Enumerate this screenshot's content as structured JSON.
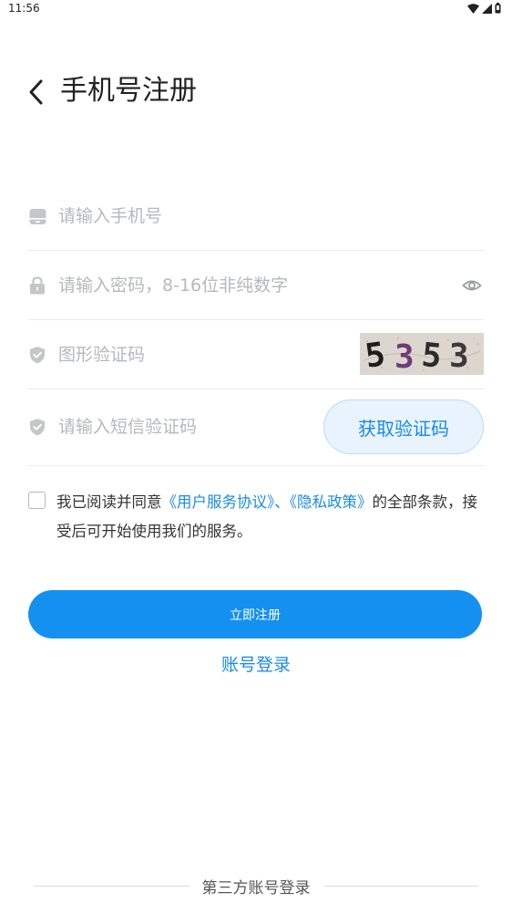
{
  "status_bar": {
    "time": "11:56"
  },
  "header": {
    "title": "手机号注册"
  },
  "form": {
    "phone": {
      "placeholder": "请输入手机号",
      "icon": "phone-icon"
    },
    "password": {
      "placeholder": "请输入密码，8-16位非纯数字",
      "icon": "lock-icon",
      "toggle_icon": "eye-icon"
    },
    "captcha": {
      "placeholder": "图形验证码",
      "icon": "shield-check-icon",
      "captcha_text": "5353"
    },
    "sms": {
      "placeholder": "请输入短信验证码",
      "icon": "shield-check-icon",
      "button_label": "获取验证码"
    }
  },
  "agreement": {
    "prefix": "我已阅读并同意",
    "user_agreement": "《用户服务协议》",
    "separator": "、",
    "privacy_policy": "《隐私政策》",
    "suffix": "的全部条款，接受后可开始使用我们的服务。",
    "checked": false
  },
  "actions": {
    "register_label": "立即注册",
    "account_login_label": "账号登录"
  },
  "third_party": {
    "label": "第三方账号登录"
  },
  "colors": {
    "accent": "#1490f0",
    "link": "#1a8ae8",
    "placeholder": "#b6b8bc"
  }
}
